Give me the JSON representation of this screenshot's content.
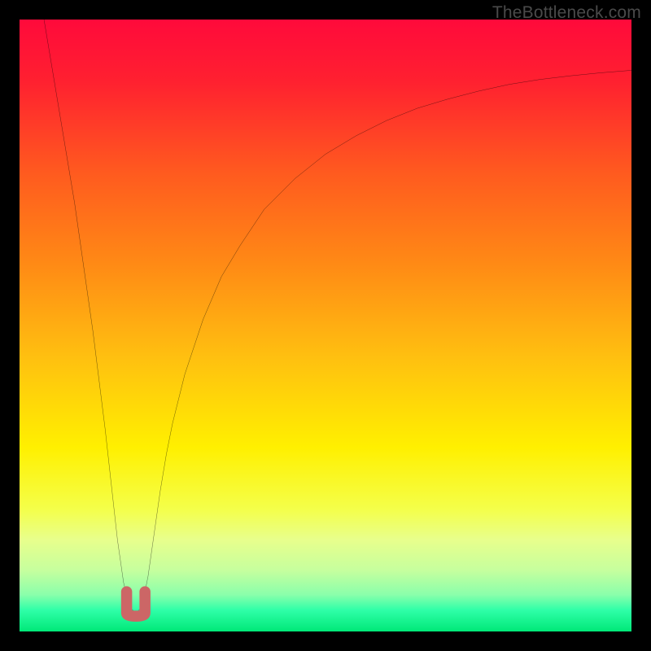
{
  "watermark": "TheBottleneck.com",
  "chart_data": {
    "type": "line",
    "title": "",
    "xlabel": "",
    "ylabel": "",
    "xlim": [
      0,
      100
    ],
    "ylim": [
      0,
      100
    ],
    "grid": false,
    "background_gradient": {
      "stops": [
        {
          "pos": 0.0,
          "color": "#ff0a3b"
        },
        {
          "pos": 0.1,
          "color": "#ff2030"
        },
        {
          "pos": 0.25,
          "color": "#ff5a1f"
        },
        {
          "pos": 0.4,
          "color": "#ff8a15"
        },
        {
          "pos": 0.55,
          "color": "#ffbf10"
        },
        {
          "pos": 0.7,
          "color": "#fff000"
        },
        {
          "pos": 0.8,
          "color": "#f4ff4a"
        },
        {
          "pos": 0.85,
          "color": "#e8ff8c"
        },
        {
          "pos": 0.9,
          "color": "#c6ff9e"
        },
        {
          "pos": 0.94,
          "color": "#8affab"
        },
        {
          "pos": 0.965,
          "color": "#2fffa8"
        },
        {
          "pos": 1.0,
          "color": "#00e878"
        }
      ]
    },
    "series": [
      {
        "name": "bottleneck-curve",
        "color": "#000000",
        "stroke_width": 2,
        "x": [
          4,
          5,
          6,
          7,
          8,
          9,
          10,
          11,
          12,
          13,
          14,
          15,
          16,
          17,
          18,
          19,
          20,
          21,
          22,
          23,
          24,
          25,
          27,
          30,
          33,
          36,
          40,
          45,
          50,
          55,
          60,
          65,
          70,
          75,
          80,
          85,
          90,
          95,
          100
        ],
        "y": [
          100,
          94,
          88,
          82,
          76,
          70,
          63,
          56,
          49,
          41,
          33,
          24,
          15,
          8,
          4,
          3,
          4,
          9,
          16,
          23,
          29,
          34,
          42,
          51,
          58,
          63,
          69,
          74,
          78,
          81,
          83.5,
          85.5,
          87,
          88.3,
          89.4,
          90.2,
          90.8,
          91.3,
          91.7
        ]
      }
    ],
    "marker": {
      "name": "optimal-point",
      "color": "#cc6666",
      "shape": "u",
      "x_range": [
        17.5,
        20.5
      ],
      "y_range": [
        2.5,
        6.5
      ],
      "stroke_width": 13
    }
  }
}
